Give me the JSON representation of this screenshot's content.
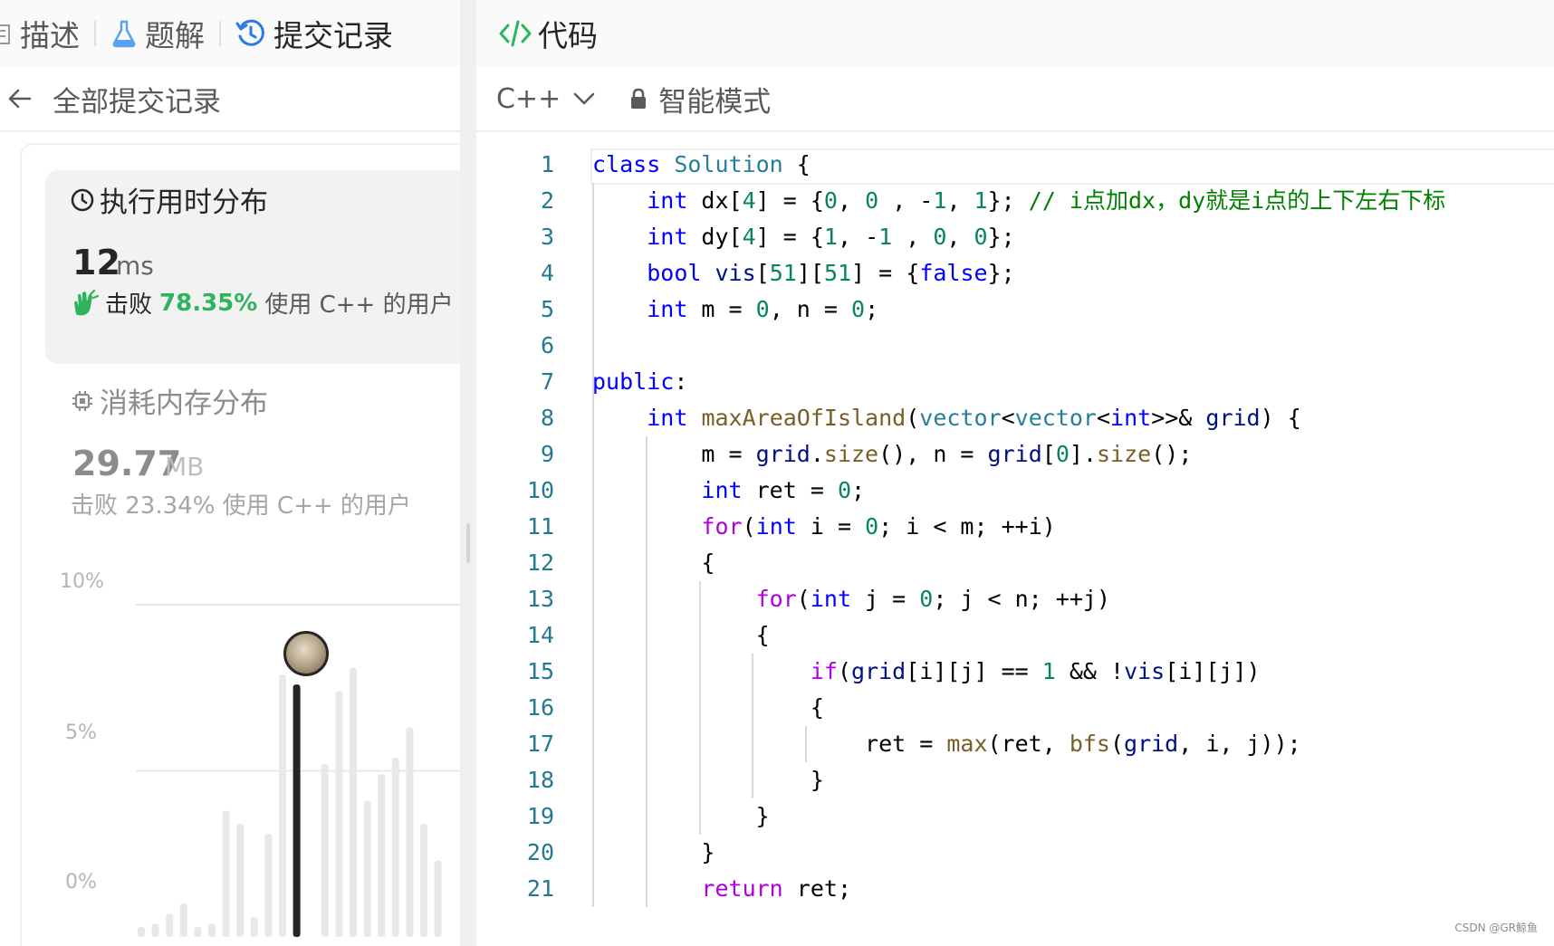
{
  "tabs": [
    {
      "label": "描述",
      "icon": "document-icon"
    },
    {
      "label": "题解",
      "icon": "flask-icon"
    },
    {
      "label": "提交记录",
      "icon": "history-icon"
    }
  ],
  "back_bar": {
    "title": "全部提交记录",
    "icon": "arrow-left-icon"
  },
  "runtime": {
    "title": "执行用时分布",
    "icon": "clock-icon",
    "value": "12",
    "unit": "ms",
    "beat_label": "击败",
    "beat_percent": "78.35%",
    "beat_suffix": "使用 C++ 的用户",
    "beat_icon": "clapping-hands-icon"
  },
  "memory": {
    "title": "消耗内存分布",
    "icon": "chip-icon",
    "value": "29.77",
    "unit": "MB",
    "beat_text": "击败 23.34% 使用 C++ 的用户"
  },
  "chart_data": {
    "type": "bar",
    "y_ticks": [
      "10%",
      "5%",
      "0%"
    ],
    "ylim": [
      0,
      10
    ],
    "values": [
      0.3,
      0.4,
      0.7,
      1.0,
      0.3,
      0.4,
      3.8,
      3.4,
      0.6,
      3.1,
      7.9,
      7.6,
      0.0,
      5.2,
      7.4,
      8.1,
      4.1,
      4.9,
      5.4,
      6.3,
      3.4,
      2.3
    ],
    "highlight_value": 7.6,
    "colors": {
      "bar": "#e8e8e8",
      "highlight": "#262626",
      "grid": "#e8e8e8"
    }
  },
  "code_panel": {
    "title": "代码",
    "icon": "code-icon",
    "language": "C++",
    "mode": "智能模式",
    "mode_icon": "lock-icon"
  },
  "code_lines": [
    "class Solution {",
    "    int dx[4] = {0, 0 , -1, 1}; // i点加dx，dy就是i点的上下左右下标",
    "    int dy[4] = {1, -1 , 0, 0};",
    "    bool vis[51][51] = {false};",
    "    int m = 0, n = 0;",
    "",
    "public:",
    "    int maxAreaOfIsland(vector<vector<int>>& grid) {",
    "        m = grid.size(), n = grid[0].size();",
    "        int ret = 0;",
    "        for(int i = 0; i < m; ++i)",
    "        {",
    "            for(int j = 0; j < n; ++j)",
    "            {",
    "                if(grid[i][j] == 1 && !vis[i][j])",
    "                {",
    "                    ret = max(ret, bfs(grid, i, j));",
    "                }",
    "            }",
    "        }",
    "        return ret;"
  ],
  "watermark": "CSDN @GR鲸鱼"
}
